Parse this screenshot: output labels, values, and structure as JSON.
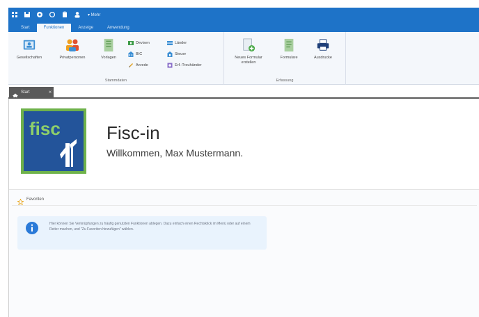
{
  "quick_access": {
    "icons": [
      "app-icon",
      "save-icon",
      "globe-icon",
      "refresh-icon",
      "clipboard-icon",
      "user-icon"
    ],
    "dropdown_label": "▾ Mehr"
  },
  "ribbon_tabs": [
    {
      "label": "Start",
      "active": false
    },
    {
      "label": "Funktionen",
      "active": true
    },
    {
      "label": "Anzeige",
      "active": false
    },
    {
      "label": "Anwendung",
      "active": false
    }
  ],
  "ribbon": {
    "stammdaten": {
      "label": "Stammdaten",
      "big_buttons": [
        {
          "label": "Gesellschaften",
          "icon": "company-icon"
        },
        {
          "label": "Privatpersonen",
          "icon": "persons-icon"
        },
        {
          "label": "Vorlagen",
          "icon": "templates-icon"
        }
      ],
      "small_buttons": [
        {
          "label": "Devisen",
          "icon": "currency-icon"
        },
        {
          "label": "BIC",
          "icon": "bank-icon"
        },
        {
          "label": "Anrede",
          "icon": "pen-icon"
        },
        {
          "label": "Länder",
          "icon": "flag-icon"
        },
        {
          "label": "Steuer",
          "icon": "tax-icon"
        },
        {
          "label": "Erf.-Treuhänder",
          "icon": "trustee-icon"
        }
      ]
    },
    "erfassung": {
      "label": "Erfassung",
      "big_buttons": [
        {
          "label": "Neues Formular\nerstellen",
          "icon": "new-form-icon"
        },
        {
          "label": "Formulare",
          "icon": "forms-icon"
        },
        {
          "label": "Ausdrucke",
          "icon": "printer-icon"
        }
      ]
    }
  },
  "document_tab": {
    "label": "Start",
    "close": "×"
  },
  "header": {
    "logo_text": "fisc",
    "app_title": "Fisc-in",
    "welcome": "Willkommen, Max Mustermann."
  },
  "favorites": {
    "label": "Favoriten",
    "info_text": "Hier können Sie Verknüpfungen zu häufig genutzten Funktionen ablegen. Dazu einfach einen Rechtsklick im Menü oder auf einem Reiter machen, und \"Zu Favoriten hinzufügen\" wählen."
  },
  "colors": {
    "accent": "#1e73c8",
    "tab_dark": "#5a5a5a",
    "logo_blue": "#23549a",
    "logo_green": "#6fb24b",
    "info_bg": "#e9f3fd",
    "info_icon": "#2a7ad8"
  }
}
